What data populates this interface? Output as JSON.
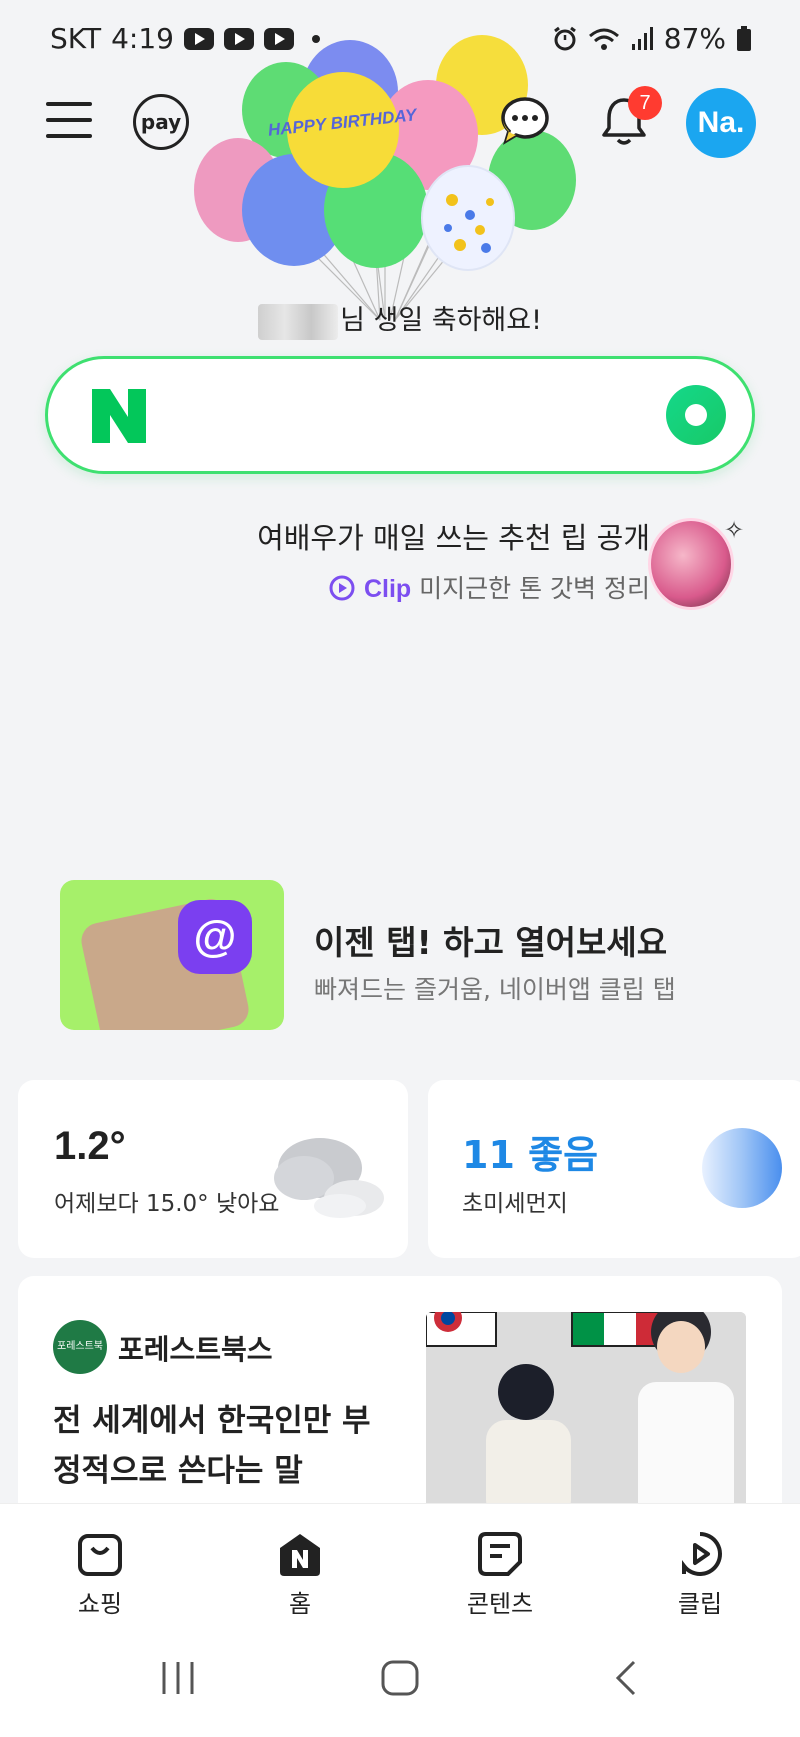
{
  "status_bar": {
    "carrier": "SKT",
    "time": "4:19",
    "battery": "87%"
  },
  "top_bar": {
    "pay_label": "pay",
    "notification_count": "7",
    "avatar_label": "Na."
  },
  "birthday": {
    "balloon_text": "HAPPY BIRTHDAY",
    "message": "님 생일 축하해요!"
  },
  "search": {
    "placeholder": "",
    "logo": "N"
  },
  "promo": {
    "title": "여배우가 매일 쓰는 추천 립 공개",
    "clip_label": "Clip",
    "subtitle": "미지근한 톤 갓벽 정리"
  },
  "banner": {
    "title": "이젠 탭! 하고 열어보세요",
    "subtitle": "빠져드는 즐거움, 네이버앱 클립 탭"
  },
  "weather": {
    "temperature": "1.2°",
    "comparison": "어제보다 15.0° 낮아요"
  },
  "dust": {
    "value": "11 좋음",
    "label": "초미세먼지"
  },
  "article": {
    "publisher": "포레스트북스",
    "publisher_logo": "포레스트북스",
    "title": "전 세계에서 한국인만 부정적으로 쓴다는 말"
  },
  "bottom_nav": {
    "items": [
      {
        "label": "쇼핑",
        "icon": "shopping-bag-icon"
      },
      {
        "label": "홈",
        "icon": "home-n-icon"
      },
      {
        "label": "콘텐츠",
        "icon": "contents-icon"
      },
      {
        "label": "클립",
        "icon": "clip-play-icon"
      }
    ]
  },
  "colors": {
    "naver_green": "#03c75a",
    "search_border": "#3ee070",
    "badge_red": "#ff3b30",
    "avatar_blue": "#1ba6f0",
    "dust_blue": "#1e88e5"
  }
}
